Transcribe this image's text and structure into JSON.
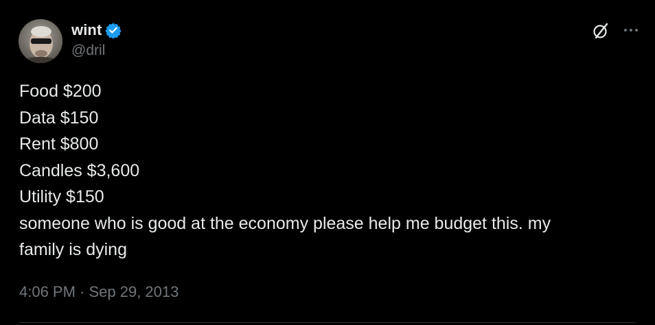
{
  "author": {
    "display_name": "wint",
    "handle": "@dril",
    "avatar_icon": "avatar-photo",
    "verified_color": "#1d9bf0"
  },
  "actions": {
    "grok_icon": "slashed-circle-icon",
    "more_icon": "more-dots-icon"
  },
  "tweet": {
    "lines": [
      "Food $200",
      "Data $150",
      "Rent $800",
      "Candles $3,600",
      "Utility $150",
      "someone who is good at the economy please help me budget this. my",
      "family is dying"
    ],
    "timestamp": "4:06 PM · Sep 29, 2013"
  },
  "colors": {
    "background": "#000000",
    "text": "#e7e9ea",
    "secondary_text": "#71767b",
    "divider": "#2f3336"
  }
}
